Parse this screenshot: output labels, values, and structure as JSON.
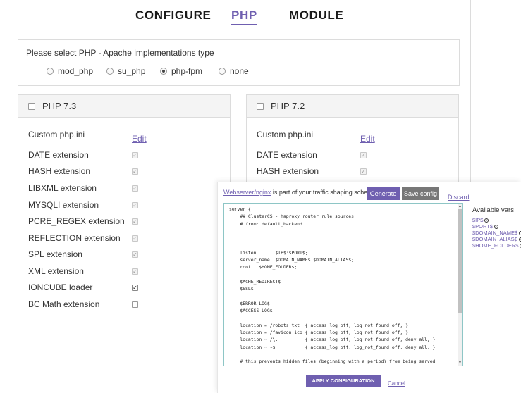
{
  "tabs": [
    {
      "label": "CONFIGURE"
    },
    {
      "label": "PHP"
    },
    {
      "label": "MODULE"
    }
  ],
  "apache_type": {
    "title": "Please select PHP - Apache implementations type",
    "options": [
      {
        "label": "mod_php",
        "checked": false
      },
      {
        "label": "su_php",
        "checked": false
      },
      {
        "label": "php-fpm",
        "checked": true
      },
      {
        "label": "none",
        "checked": false
      }
    ]
  },
  "php73": {
    "title": "PHP 7.3",
    "custom_label": "Custom php.ini",
    "edit_label": "Edit",
    "extensions": [
      {
        "label": "DATE extension"
      },
      {
        "label": "HASH extension"
      },
      {
        "label": "LIBXML extension"
      },
      {
        "label": "MYSQLI extension"
      },
      {
        "label": "PCRE_REGEX extension"
      },
      {
        "label": "REFLECTION extension"
      },
      {
        "label": "SPL extension"
      },
      {
        "label": "XML extension"
      },
      {
        "label": "IONCUBE loader"
      },
      {
        "label": "BC Math extension"
      }
    ]
  },
  "php72": {
    "title": "PHP 7.2",
    "custom_label": "Custom php.ini",
    "edit_label": "Edit",
    "extensions": [
      {
        "label": "DATE extension"
      },
      {
        "label": "HASH extension"
      }
    ]
  },
  "overlay": {
    "link_text": "Webserver/nginx",
    "header_text": " is part of your traffic shaping schema.",
    "generate_label": "Generate",
    "save_label": "Save config",
    "discard_label": "Discard",
    "code": "server {\n    ## ClusterCS - haproxy router rule sources\n    # from: default_backend\n\n\n\n    listen       $IP$:$PORT$;\n    server_name  $DOMAIN_NAME$ $DOMAIN_ALIAS$;\n    root   $HOME_FOLDER$;\n\n    $ACHE_REDIRECT$\n    $SSL$\n\n    $ERROR_LOG$\n    $ACCESS_LOG$\n\n    location = /robots.txt  { access_log off; log_not_found off; }\n    location = /favicon.ico { access_log off; log_not_found off; }\n    location ~ /\\.          { access_log off; log_not_found off; deny all; }\n    location ~ ~$           { access_log off; log_not_found off; deny all; }\n\n    # this prevents hidden files (beginning with a period) from being served\n    location ~ /\\.          { access_log off; log_not_found off; deny all; }",
    "vars_title": "Available vars",
    "vars": [
      "$IP$",
      "$PORT$",
      "$DOMAIN_NAME$",
      "$DOMAIN_ALIAS$",
      "$HOME_FOLDER$"
    ],
    "apply_label": "APPLY CONFIGURATION",
    "cancel_label": "Cancel"
  }
}
